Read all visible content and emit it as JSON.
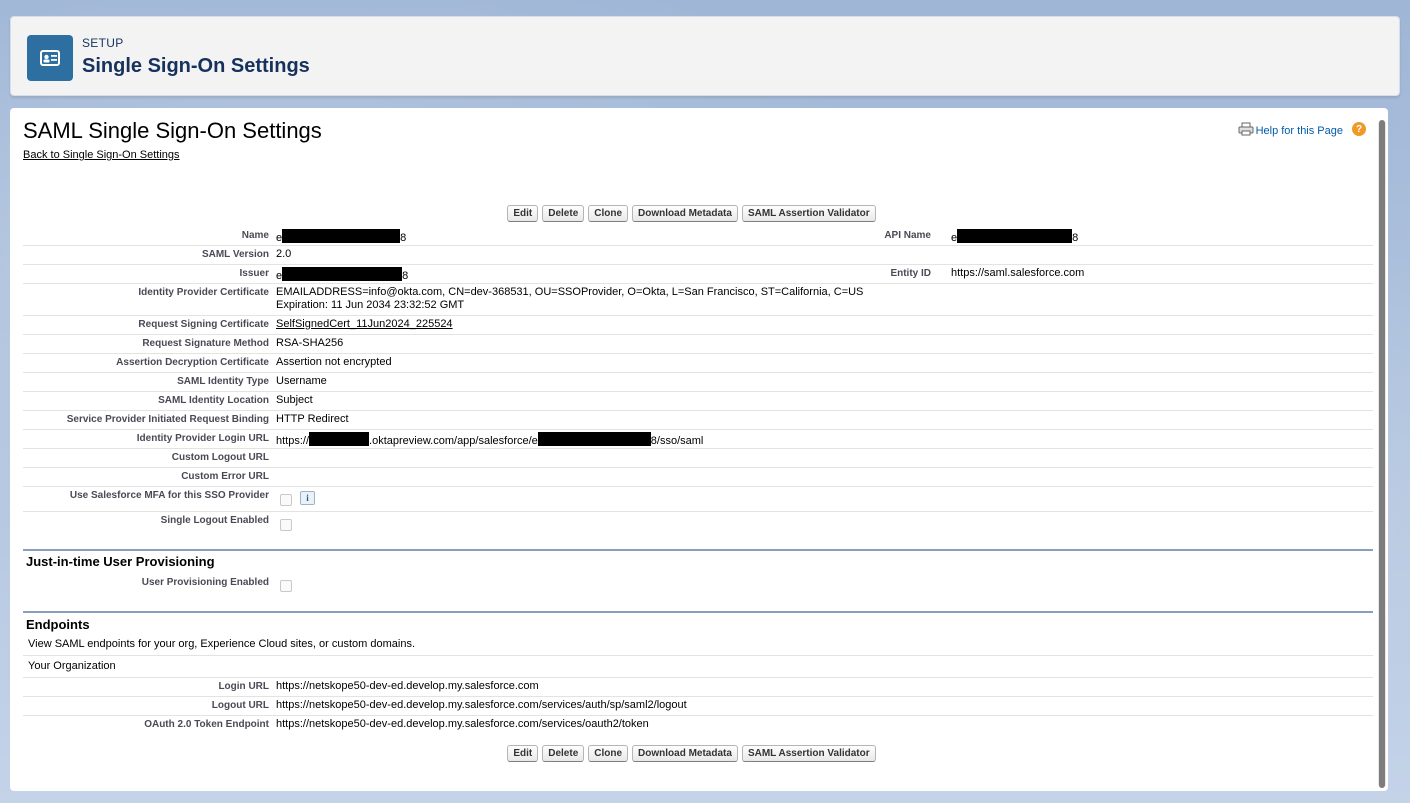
{
  "header": {
    "eyebrow": "SETUP",
    "title": "Single Sign-On Settings"
  },
  "page": {
    "title": "SAML Single Sign-On Settings",
    "back_link": "Back to Single Sign-On Settings",
    "help_link": "Help for this Page",
    "help_icon": "?"
  },
  "buttons": {
    "edit": "Edit",
    "delete": "Delete",
    "clone": "Clone",
    "download_metadata": "Download Metadata",
    "saml_validator": "SAML Assertion Validator"
  },
  "fields": {
    "name_label": "Name",
    "name_prefix": "e",
    "name_suffix": "8",
    "api_name_label": "API Name",
    "api_name_prefix": "e",
    "api_name_suffix": "8",
    "saml_version_label": "SAML Version",
    "saml_version": "2.0",
    "issuer_label": "Issuer",
    "issuer_prefix": "e",
    "issuer_suffix": "8",
    "entity_id_label": "Entity ID",
    "entity_id": "https://saml.salesforce.com",
    "idp_cert_label": "Identity Provider Certificate",
    "idp_cert_line1": "EMAILADDRESS=info@okta.com, CN=dev-368531, OU=SSOProvider, O=Okta, L=San Francisco, ST=California, C=US",
    "idp_cert_line2": "Expiration: 11 Jun 2034 23:32:52 GMT",
    "req_sign_cert_label": "Request Signing Certificate",
    "req_sign_cert": "SelfSignedCert_11Jun2024_225524",
    "req_sign_method_label": "Request Signature Method",
    "req_sign_method": "RSA-SHA256",
    "assert_decrypt_label": "Assertion Decryption Certificate",
    "assert_decrypt": "Assertion not encrypted",
    "identity_type_label": "SAML Identity Type",
    "identity_type": "Username",
    "identity_location_label": "SAML Identity Location",
    "identity_location": "Subject",
    "sp_binding_label": "Service Provider Initiated Request Binding",
    "sp_binding": "HTTP Redirect",
    "idp_login_url_label": "Identity Provider Login URL",
    "idp_login_url_a": "https://",
    "idp_login_url_b": ".oktapreview.com/app/salesforce/e",
    "idp_login_url_c": "8/sso/saml",
    "custom_logout_label": "Custom Logout URL",
    "custom_error_label": "Custom Error URL",
    "mfa_label": "Use Salesforce MFA for this SSO Provider",
    "mfa_info": "i",
    "single_logout_label": "Single Logout Enabled"
  },
  "jit": {
    "title": "Just-in-time User Provisioning",
    "enabled_label": "User Provisioning Enabled"
  },
  "endpoints": {
    "title": "Endpoints",
    "description": "View SAML endpoints for your org, Experience Cloud sites, or custom domains.",
    "org_label": "Your Organization",
    "login_url_label": "Login URL",
    "login_url": "https://netskope50-dev-ed.develop.my.salesforce.com",
    "logout_url_label": "Logout URL",
    "logout_url": "https://netskope50-dev-ed.develop.my.salesforce.com/services/auth/sp/saml2/logout",
    "oauth_label": "OAuth 2.0 Token Endpoint",
    "oauth_url": "https://netskope50-dev-ed.develop.my.salesforce.com/services/oauth2/token"
  }
}
